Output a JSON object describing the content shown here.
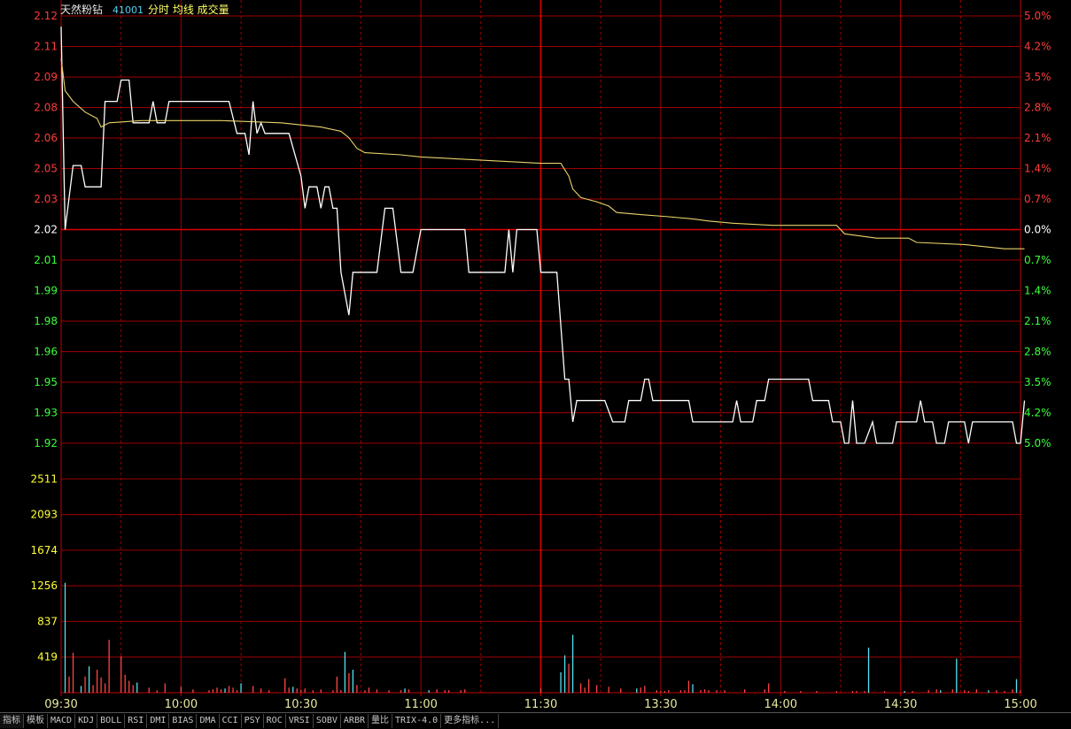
{
  "colors": {
    "background": "#000000",
    "grid": "#a00000",
    "frame": "#c00000",
    "price_line": "#ffffff",
    "avg_line": "#e8d36a",
    "up": "#ff3c3c",
    "down": "#3cff3c",
    "neutral": "#ffffff",
    "volume_axis": "#ffff33",
    "vol_up": "#ff4444",
    "vol_down": "#55e0f0",
    "title_name": "#e8e8e8",
    "title_code": "#55d0f0",
    "title_text": "#ffff66",
    "time_label": "#e8e8a0"
  },
  "header": {
    "name": "天然粉钻",
    "code": "41001",
    "mode": "分时 均线 成交量"
  },
  "toolbar": {
    "tabs": [
      "指标",
      "模板",
      "MACD",
      "KDJ",
      "BOLL",
      "RSI",
      "DMI",
      "BIAS",
      "DMA",
      "CCI",
      "PSY",
      "ROC",
      "VRSI",
      "SOBV",
      "ARBR",
      "量比",
      "TRIX-4.0",
      "更多指标..."
    ]
  },
  "chart_data": {
    "type": "line",
    "title": "",
    "prev_close": 2.02,
    "price_axis": {
      "ylim": [
        1.92,
        2.12
      ],
      "left_ticks": [
        "2.12",
        "2.11",
        "2.09",
        "2.08",
        "2.06",
        "2.05",
        "2.03",
        "2.02",
        "2.01",
        "1.99",
        "1.98",
        "1.96",
        "1.95",
        "1.93",
        "1.92"
      ],
      "right_ticks": [
        "5.0%",
        "4.2%",
        "3.5%",
        "2.8%",
        "2.1%",
        "1.4%",
        "0.7%",
        "0.0%",
        "0.7%",
        "1.4%",
        "2.1%",
        "2.8%",
        "3.5%",
        "4.2%",
        "5.0%"
      ]
    },
    "volume_axis": {
      "ylim": [
        0,
        2930
      ],
      "ticks": [
        "2511",
        "2093",
        "1674",
        "1256",
        "837",
        "419"
      ]
    },
    "x_axis": {
      "minutes_total": 240,
      "ticks": [
        {
          "label": "09:30",
          "minute": 0
        },
        {
          "label": "10:00",
          "minute": 30
        },
        {
          "label": "10:30",
          "minute": 60
        },
        {
          "label": "11:00",
          "minute": 90
        },
        {
          "label": "11:30",
          "minute": 120
        },
        {
          "label": "13:30",
          "minute": 150
        },
        {
          "label": "14:00",
          "minute": 180
        },
        {
          "label": "14:30",
          "minute": 210
        },
        {
          "label": "15:00",
          "minute": 240
        }
      ]
    },
    "series": [
      {
        "key": "price",
        "points": [
          [
            0,
            2.115
          ],
          [
            1,
            2.02
          ],
          [
            3,
            2.05
          ],
          [
            5,
            2.05
          ],
          [
            6,
            2.04
          ],
          [
            10,
            2.04
          ],
          [
            11,
            2.08
          ],
          [
            14,
            2.08
          ],
          [
            15,
            2.09
          ],
          [
            17,
            2.09
          ],
          [
            18,
            2.07
          ],
          [
            22,
            2.07
          ],
          [
            23,
            2.08
          ],
          [
            24,
            2.07
          ],
          [
            26,
            2.07
          ],
          [
            27,
            2.08
          ],
          [
            42,
            2.08
          ],
          [
            44,
            2.065
          ],
          [
            46,
            2.065
          ],
          [
            47,
            2.055
          ],
          [
            48,
            2.08
          ],
          [
            49,
            2.065
          ],
          [
            50,
            2.07
          ],
          [
            51,
            2.065
          ],
          [
            57,
            2.065
          ],
          [
            60,
            2.045
          ],
          [
            61,
            2.03
          ],
          [
            62,
            2.04
          ],
          [
            64,
            2.04
          ],
          [
            65,
            2.03
          ],
          [
            66,
            2.04
          ],
          [
            67,
            2.04
          ],
          [
            68,
            2.03
          ],
          [
            69,
            2.03
          ],
          [
            70,
            2.0
          ],
          [
            72,
            1.98
          ],
          [
            73,
            2.0
          ],
          [
            79,
            2.0
          ],
          [
            81,
            2.03
          ],
          [
            83,
            2.03
          ],
          [
            85,
            2.0
          ],
          [
            88,
            2.0
          ],
          [
            90,
            2.02
          ],
          [
            101,
            2.02
          ],
          [
            102,
            2.0
          ],
          [
            111,
            2.0
          ],
          [
            112,
            2.02
          ],
          [
            113,
            2.0
          ],
          [
            114,
            2.02
          ],
          [
            119,
            2.02
          ],
          [
            120,
            2.0
          ],
          [
            124,
            2.0
          ],
          [
            126,
            1.95
          ],
          [
            127,
            1.95
          ],
          [
            128,
            1.93
          ],
          [
            129,
            1.94
          ],
          [
            136,
            1.94
          ],
          [
            138,
            1.93
          ],
          [
            141,
            1.93
          ],
          [
            142,
            1.94
          ],
          [
            145,
            1.94
          ],
          [
            146,
            1.95
          ],
          [
            147,
            1.95
          ],
          [
            148,
            1.94
          ],
          [
            157,
            1.94
          ],
          [
            158,
            1.93
          ],
          [
            168,
            1.93
          ],
          [
            169,
            1.94
          ],
          [
            170,
            1.93
          ],
          [
            173,
            1.93
          ],
          [
            174,
            1.94
          ],
          [
            176,
            1.94
          ],
          [
            177,
            1.95
          ],
          [
            187,
            1.95
          ],
          [
            188,
            1.94
          ],
          [
            192,
            1.94
          ],
          [
            193,
            1.93
          ],
          [
            195,
            1.93
          ],
          [
            196,
            1.92
          ],
          [
            197,
            1.92
          ],
          [
            198,
            1.94
          ],
          [
            199,
            1.92
          ],
          [
            201,
            1.92
          ],
          [
            203,
            1.93
          ],
          [
            204,
            1.92
          ],
          [
            208,
            1.92
          ],
          [
            209,
            1.93
          ],
          [
            214,
            1.93
          ],
          [
            215,
            1.94
          ],
          [
            216,
            1.93
          ],
          [
            218,
            1.93
          ],
          [
            219,
            1.92
          ],
          [
            221,
            1.92
          ],
          [
            222,
            1.93
          ],
          [
            226,
            1.93
          ],
          [
            227,
            1.92
          ],
          [
            228,
            1.93
          ],
          [
            238,
            1.93
          ],
          [
            239,
            1.92
          ],
          [
            240,
            1.92
          ],
          [
            241,
            1.94
          ]
        ]
      },
      {
        "key": "avg",
        "points": [
          [
            0,
            2.1
          ],
          [
            1,
            2.085
          ],
          [
            3,
            2.08
          ],
          [
            6,
            2.075
          ],
          [
            9,
            2.072
          ],
          [
            10,
            2.068
          ],
          [
            12,
            2.07
          ],
          [
            20,
            2.071
          ],
          [
            40,
            2.071
          ],
          [
            55,
            2.07
          ],
          [
            65,
            2.068
          ],
          [
            70,
            2.066
          ],
          [
            72,
            2.063
          ],
          [
            74,
            2.058
          ],
          [
            76,
            2.056
          ],
          [
            85,
            2.055
          ],
          [
            90,
            2.054
          ],
          [
            110,
            2.052
          ],
          [
            120,
            2.051
          ],
          [
            125,
            2.051
          ],
          [
            127,
            2.045
          ],
          [
            128,
            2.039
          ],
          [
            130,
            2.035
          ],
          [
            134,
            2.033
          ],
          [
            137,
            2.031
          ],
          [
            139,
            2.028
          ],
          [
            145,
            2.027
          ],
          [
            152,
            2.026
          ],
          [
            158,
            2.025
          ],
          [
            162,
            2.024
          ],
          [
            168,
            2.023
          ],
          [
            178,
            2.022
          ],
          [
            194,
            2.022
          ],
          [
            196,
            2.018
          ],
          [
            204,
            2.016
          ],
          [
            212,
            2.016
          ],
          [
            214,
            2.014
          ],
          [
            226,
            2.013
          ],
          [
            236,
            2.011
          ],
          [
            241,
            2.011
          ]
        ]
      }
    ],
    "volume": [
      [
        1,
        1290,
        "down"
      ],
      [
        2,
        190,
        "up"
      ],
      [
        3,
        470,
        "up"
      ],
      [
        5,
        80,
        "down"
      ],
      [
        6,
        190,
        "up"
      ],
      [
        7,
        310,
        "down"
      ],
      [
        8,
        90,
        "up"
      ],
      [
        9,
        270,
        "up"
      ],
      [
        10,
        180,
        "up"
      ],
      [
        11,
        110,
        "up"
      ],
      [
        12,
        620,
        "up"
      ],
      [
        15,
        430,
        "up"
      ],
      [
        16,
        210,
        "up"
      ],
      [
        17,
        140,
        "up"
      ],
      [
        18,
        90,
        "up"
      ],
      [
        19,
        120,
        "down"
      ],
      [
        22,
        60,
        "up"
      ],
      [
        24,
        30,
        "up"
      ],
      [
        26,
        110,
        "up"
      ],
      [
        30,
        70,
        "up"
      ],
      [
        33,
        40,
        "up"
      ],
      [
        37,
        30,
        "up"
      ],
      [
        38,
        40,
        "up"
      ],
      [
        39,
        60,
        "up"
      ],
      [
        40,
        40,
        "up"
      ],
      [
        41,
        50,
        "down"
      ],
      [
        42,
        80,
        "up"
      ],
      [
        43,
        60,
        "up"
      ],
      [
        44,
        30,
        "up"
      ],
      [
        45,
        110,
        "down"
      ],
      [
        48,
        80,
        "up"
      ],
      [
        50,
        50,
        "up"
      ],
      [
        52,
        30,
        "up"
      ],
      [
        56,
        170,
        "up"
      ],
      [
        57,
        60,
        "up"
      ],
      [
        58,
        70,
        "down"
      ],
      [
        59,
        50,
        "up"
      ],
      [
        60,
        30,
        "up"
      ],
      [
        61,
        50,
        "up"
      ],
      [
        63,
        30,
        "up"
      ],
      [
        65,
        40,
        "up"
      ],
      [
        68,
        30,
        "up"
      ],
      [
        69,
        190,
        "up"
      ],
      [
        70,
        30,
        "up"
      ],
      [
        71,
        480,
        "down"
      ],
      [
        72,
        230,
        "up"
      ],
      [
        73,
        270,
        "down"
      ],
      [
        74,
        90,
        "up"
      ],
      [
        76,
        30,
        "up"
      ],
      [
        77,
        60,
        "up"
      ],
      [
        79,
        40,
        "up"
      ],
      [
        82,
        30,
        "up"
      ],
      [
        85,
        30,
        "up"
      ],
      [
        86,
        50,
        "down"
      ],
      [
        87,
        40,
        "up"
      ],
      [
        92,
        30,
        "down"
      ],
      [
        94,
        40,
        "up"
      ],
      [
        96,
        30,
        "up"
      ],
      [
        97,
        30,
        "up"
      ],
      [
        100,
        30,
        "up"
      ],
      [
        101,
        40,
        "up"
      ],
      [
        120,
        50,
        "up"
      ],
      [
        125,
        240,
        "down"
      ],
      [
        126,
        440,
        "down"
      ],
      [
        127,
        340,
        "up"
      ],
      [
        128,
        680,
        "down"
      ],
      [
        130,
        110,
        "up"
      ],
      [
        131,
        60,
        "up"
      ],
      [
        132,
        160,
        "up"
      ],
      [
        134,
        90,
        "up"
      ],
      [
        137,
        70,
        "up"
      ],
      [
        140,
        50,
        "up"
      ],
      [
        144,
        50,
        "down"
      ],
      [
        145,
        60,
        "up"
      ],
      [
        146,
        80,
        "up"
      ],
      [
        149,
        30,
        "up"
      ],
      [
        150,
        20,
        "up"
      ],
      [
        151,
        20,
        "up"
      ],
      [
        152,
        30,
        "up"
      ],
      [
        155,
        30,
        "up"
      ],
      [
        156,
        30,
        "up"
      ],
      [
        157,
        140,
        "up"
      ],
      [
        158,
        100,
        "down"
      ],
      [
        160,
        30,
        "up"
      ],
      [
        161,
        40,
        "up"
      ],
      [
        162,
        30,
        "up"
      ],
      [
        164,
        30,
        "up"
      ],
      [
        166,
        30,
        "up"
      ],
      [
        171,
        40,
        "up"
      ],
      [
        176,
        40,
        "up"
      ],
      [
        177,
        110,
        "up"
      ],
      [
        181,
        20,
        "up"
      ],
      [
        185,
        20,
        "up"
      ],
      [
        189,
        20,
        "up"
      ],
      [
        194,
        20,
        "up"
      ],
      [
        198,
        20,
        "up"
      ],
      [
        199,
        20,
        "up"
      ],
      [
        201,
        20,
        "up"
      ],
      [
        202,
        530,
        "down"
      ],
      [
        206,
        20,
        "up"
      ],
      [
        211,
        20,
        "down"
      ],
      [
        213,
        20,
        "up"
      ],
      [
        217,
        30,
        "up"
      ],
      [
        219,
        40,
        "up"
      ],
      [
        220,
        30,
        "down"
      ],
      [
        223,
        40,
        "up"
      ],
      [
        224,
        400,
        "down"
      ],
      [
        226,
        30,
        "up"
      ],
      [
        227,
        20,
        "up"
      ],
      [
        229,
        40,
        "up"
      ],
      [
        232,
        30,
        "down"
      ],
      [
        234,
        30,
        "up"
      ],
      [
        236,
        20,
        "up"
      ],
      [
        238,
        40,
        "up"
      ],
      [
        239,
        160,
        "down"
      ],
      [
        240,
        30,
        "up"
      ]
    ]
  }
}
